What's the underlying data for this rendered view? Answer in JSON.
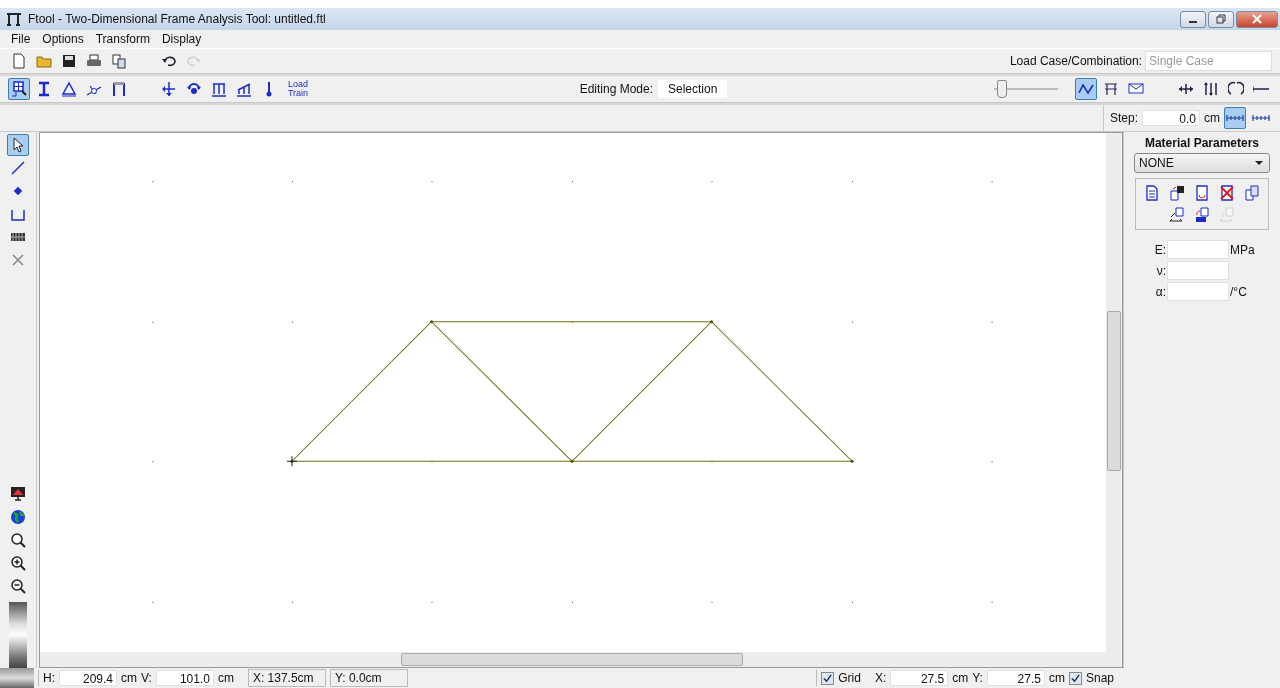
{
  "window": {
    "title": "Ftool - Two-Dimensional Frame Analysis Tool: untitled.ftl"
  },
  "menu": [
    "File",
    "Options",
    "Transform",
    "Display"
  ],
  "file_tools": [
    {
      "disabled": false
    },
    {
      "disabled": false
    },
    {
      "disabled": false
    },
    {
      "disabled": false
    },
    {
      "disabled": false
    },
    {
      "disabled": false
    },
    {
      "disabled": true
    }
  ],
  "load_case": {
    "label": "Load Case/Combination:",
    "value": "Single Case",
    "disabled": true
  },
  "mode_tools": [
    {
      "selected": true
    },
    {
      "selected": false
    },
    {
      "selected": false
    },
    {
      "selected": false
    },
    {
      "selected": false
    }
  ],
  "load_tools": [
    {
      "kind": "icon",
      "selected": false
    },
    {
      "kind": "icon",
      "selected": false
    },
    {
      "kind": "icon",
      "selected": false
    },
    {
      "kind": "icon",
      "selected": false
    },
    {
      "kind": "icon",
      "selected": false
    },
    {
      "kind": "text",
      "label": "Load Train",
      "selected": false
    }
  ],
  "editing_mode": {
    "label": "Editing Mode:",
    "value": "Selection"
  },
  "scale_slider": {
    "level": 0.05
  },
  "view_tools": [
    {
      "selected": true
    },
    {
      "selected": false
    },
    {
      "selected": false
    }
  ],
  "result_tools": [
    {
      "selected": false
    },
    {
      "selected": false
    },
    {
      "selected": false
    },
    {
      "selected": false
    }
  ],
  "step": {
    "label": "Step:",
    "value": "0.0",
    "unit": "cm"
  },
  "step_modes": [
    {
      "selected": true
    },
    {
      "selected": false
    }
  ],
  "left_tools": [
    {
      "selected": true
    },
    {
      "selected": false
    },
    {
      "selected": false
    },
    {
      "selected": false
    },
    {
      "selected": false
    },
    {
      "selected": false
    }
  ],
  "material": {
    "title": "Material Parameters",
    "value": "NONE",
    "actions": [
      {
        "disabled": false
      },
      {
        "disabled": false
      },
      {
        "disabled": false
      },
      {
        "disabled": false
      },
      {
        "disabled": false
      },
      {
        "disabled": false
      },
      {
        "disabled": false
      },
      {
        "disabled": true
      }
    ],
    "fields": [
      {
        "label": "E:",
        "unit": "MPa"
      },
      {
        "label": "ν:"
      },
      {
        "label": "α:",
        "unit": "/°C"
      }
    ]
  },
  "status_bar": {
    "h_label": "H:",
    "h_value": "209.4",
    "h_unit": "cm",
    "v_label": "V:",
    "v_value": "101.0",
    "v_unit": "cm",
    "x_reading": "X: 137.5cm",
    "y_reading": "Y: 0.0cm",
    "grid": {
      "label": "Grid",
      "checked": true
    },
    "x_label": "X:",
    "x_value": "27.5",
    "x_unit": "cm",
    "y_label": "Y:",
    "y_value": "27.5",
    "y_unit": "cm",
    "snap": {
      "label": "Snap",
      "checked": true
    }
  }
}
